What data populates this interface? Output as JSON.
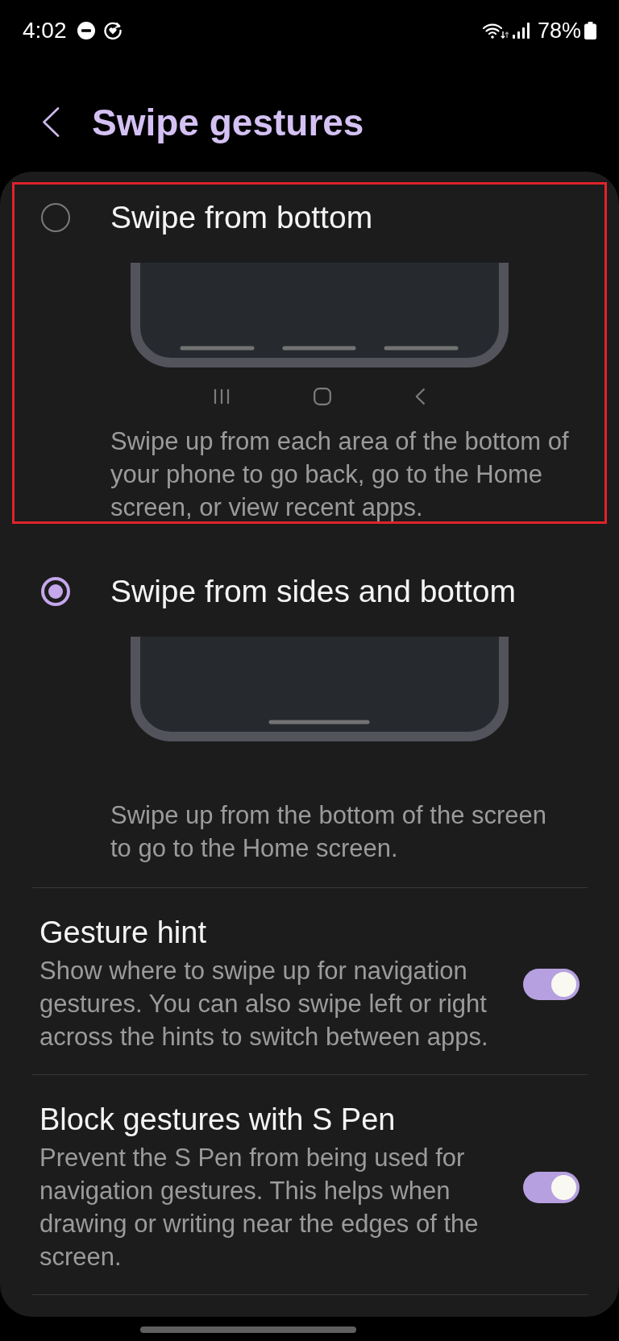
{
  "status_bar": {
    "time": "4:02",
    "battery": "78%"
  },
  "header": {
    "title": "Swipe gestures"
  },
  "options": [
    {
      "kind": "zones",
      "title": "Swipe from bottom",
      "description": "Swipe up from each area of the bottom of your phone to go back, go to the Home screen, or view recent apps.",
      "selected": false,
      "highlighted": true
    },
    {
      "kind": "sides",
      "title": "Swipe from sides and bottom",
      "description": "Swipe up from the bottom of the screen to go to the Home screen.",
      "selected": true,
      "highlighted": false
    }
  ],
  "settings": [
    {
      "title": "Gesture hint",
      "description": "Show where to swipe up for navigation gestures. You can also swipe left or right across the hints to switch between apps.",
      "on": true
    },
    {
      "title": "Block gestures with S Pen",
      "description": "Prevent the S Pen from being used for navigation gestures. This helps when drawing or writing near the edges of the screen.",
      "on": true
    }
  ]
}
